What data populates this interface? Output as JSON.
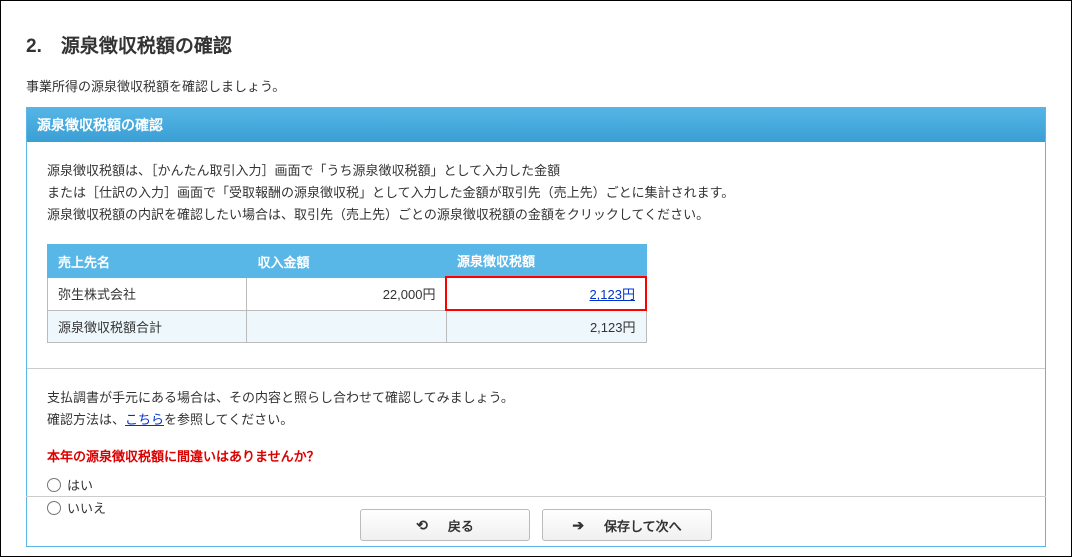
{
  "page": {
    "title": "2.　源泉徴収税額の確認",
    "desc": "事業所得の源泉徴収税額を確認しましょう。"
  },
  "panel": {
    "header": "源泉徴収税額の確認",
    "info_line1": "源泉徴収税額は、［かんたん取引入力］画面で「うち源泉徴収税額」として入力した金額",
    "info_line2": "または［仕訳の入力］画面で「受取報酬の源泉徴収税」として入力した金額が取引先（売上先）ごとに集計されます。",
    "info_line3": "源泉徴収税額の内訳を確認したい場合は、取引先（売上先）ごとの源泉徴収税額の金額をクリックしてください。"
  },
  "table": {
    "headers": {
      "name": "売上先名",
      "income": "収入金額",
      "tax": "源泉徴収税額"
    },
    "rows": [
      {
        "name": "弥生株式会社",
        "income": "22,000円",
        "tax": "2,123円"
      }
    ],
    "total": {
      "name": "源泉徴収税額合計",
      "income": "",
      "tax": "2,123円"
    }
  },
  "check": {
    "desc_line1": "支払調書が手元にある場合は、その内容と照らし合わせて確認してみましょう。",
    "desc_line2_prefix": "確認方法は、",
    "desc_line2_link": "こちら",
    "desc_line2_suffix": "を参照してください。",
    "question": "本年の源泉徴収税額に間違いはありませんか？",
    "options": {
      "yes": "はい",
      "no": "いいえ"
    }
  },
  "buttons": {
    "back": "戻る",
    "save_next": "保存して次へ"
  }
}
